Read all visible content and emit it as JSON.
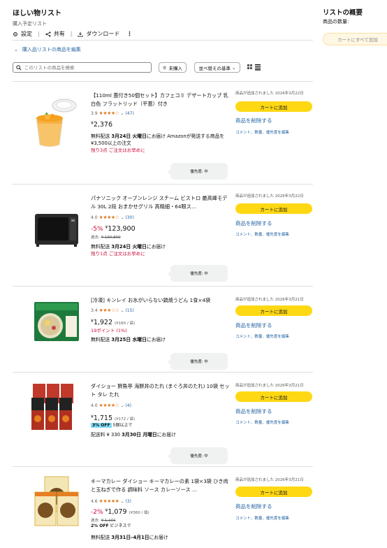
{
  "list": {
    "title": "ほしい物リスト",
    "subtitle": "購入予定リスト",
    "actions": {
      "settings": "設定",
      "share": "共有",
      "download": "ダウンロード"
    },
    "edit_link": "購入品リストの商品を編集",
    "search_placeholder": "このリストの商品を検索",
    "filter_label": "未購入",
    "sort_label": "並べ替えの基準"
  },
  "summary": {
    "title": "リストの概要",
    "count_label": "商品の数量:",
    "add_all": "カートにすべて追加"
  },
  "common": {
    "cart_button": "カートに追加",
    "delete": "商品を削除する",
    "comment": "コメント、数量、優先度を編集"
  },
  "items": [
    {
      "title": "【110ml 蓋付き50個セット】カフェコミ デザートカップ 乳白色 フラットリッド（平蓋）付き",
      "rating": "3.9",
      "stars": "★★★★☆",
      "reviews": "(47)",
      "price_yen": "¥",
      "price": "2,376",
      "line1_pre": "無料配送 ",
      "line1_bold": "3月24日 火曜日",
      "line1_post": "にお届け Amazonが発送する商品を ¥3,500以上の注文",
      "stock": "残り3点 ご注文はお早めに",
      "added": "商品が追加されました 2026年3月22日",
      "priority": "優先度: 中"
    },
    {
      "title": "パナソニック オーブンレンジ スチーム ビストロ 最高峰モデル 30L 2段 おまかせグリル 高精細・64眼ス…",
      "rating": "4.0",
      "stars": "★★★★☆",
      "reviews": "(30)",
      "discount": "-5%",
      "price_yen": "¥",
      "price": "123,900",
      "was_label": "過去:",
      "was": "¥ 130,800",
      "line1_pre": "無料配送 ",
      "line1_bold": "3月24日 火曜日",
      "line1_post": "にお届け",
      "stock": "残り1点 ご注文はお早めに",
      "added": "商品が追加されました 2026年3月22日",
      "priority": "優先度: 中"
    },
    {
      "title": "[冷凍] キンレイ お水がいらない鍋焼うどん 1食×4袋",
      "rating": "3.4",
      "stars": "★★★☆☆",
      "reviews": "(15)",
      "price_yen": "¥",
      "price": "1,922",
      "unit": "(¥160 / 袋)",
      "points": "19ポイント (1%)",
      "line1_pre": "無料配送 ",
      "line1_bold": "3月25日 水曜日",
      "line1_post": "にお届け",
      "added": "商品が追加されました 2026年3月21日",
      "priority": "優先度: 中"
    },
    {
      "title": "ダイショー 鮮魚亭 海鮮丼のたれ (まぐろ丼のたれ) 10袋 セット タレ たれ",
      "rating": "4.0",
      "stars": "★★★★☆",
      "reviews": "(4)",
      "price_yen": "¥",
      "price": "1,715",
      "unit": "(¥172 / 袋)",
      "badge": "3% OFF",
      "badge_note": "5個以上で",
      "line1_pre": "配送料 ¥ 330 ",
      "line1_bold": "3月30日 月曜日",
      "line1_post": "にお届け",
      "added": "商品が追加されました 2026年3月21日",
      "priority": "優先度: 中"
    },
    {
      "title": "キーマカレー ダイショー キーマカレーの素 1袋×3袋 ひき肉と玉ねぎで作る 調味料 ソース カレーソース …",
      "rating": "4.6",
      "stars": "★★★★★",
      "reviews": "(3)",
      "discount": "-2%",
      "price_yen": "¥",
      "price": "1,079",
      "unit": "(¥360 / 個)",
      "was_label": "過去:",
      "was": "¥ 1,101",
      "badge_plain": "2% OFF",
      "badge_plain_note": "ビジネスで",
      "line1_pre": "無料配送 ",
      "line1_bold": "3月31日–4月1日",
      "line1_post": "にお届け",
      "added": "商品が追加されました 2026年3月21日"
    }
  ]
}
